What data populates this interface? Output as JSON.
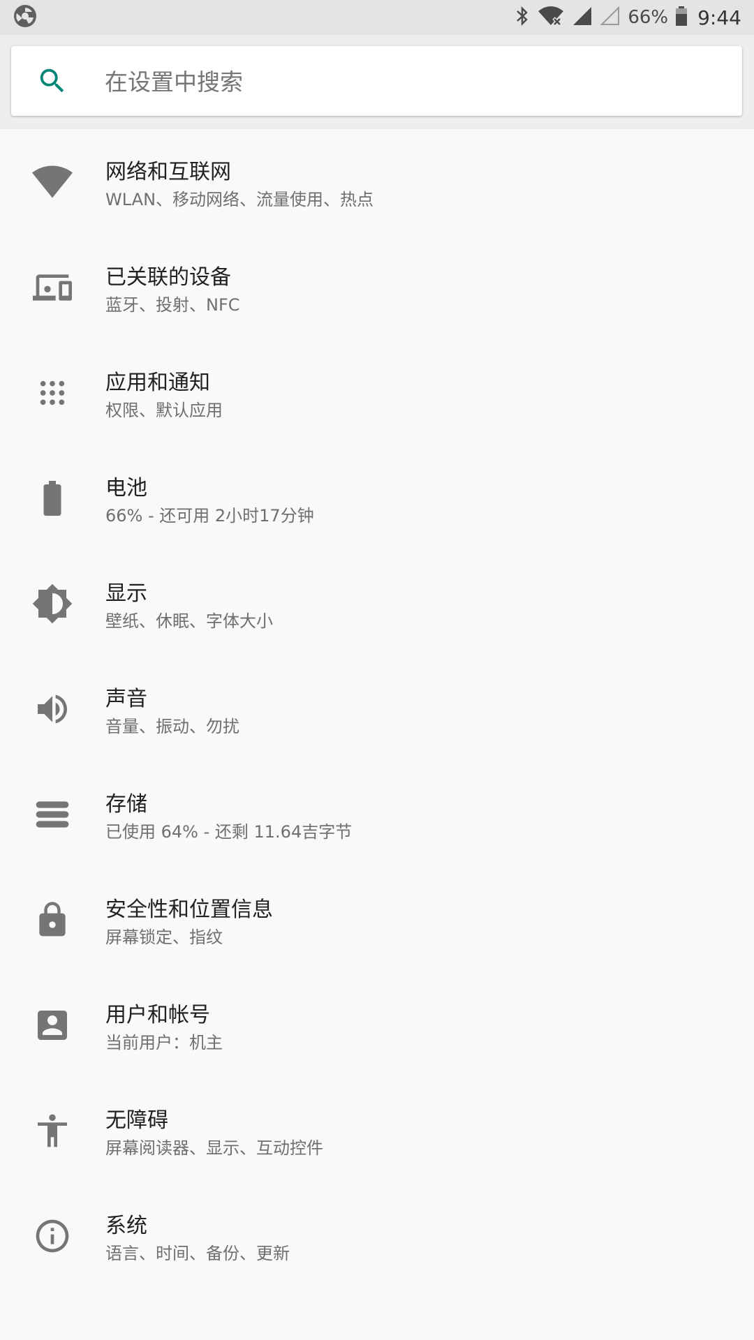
{
  "status_bar": {
    "battery_text": "66%",
    "time": "9:44",
    "icons": [
      "app-logo-icon",
      "bluetooth-icon",
      "wifi-off-icon",
      "signal-full-icon",
      "signal-empty-icon",
      "battery-icon"
    ]
  },
  "search": {
    "placeholder": "在设置中搜索",
    "icon": "search-icon",
    "accent_color": "#008577"
  },
  "settings": {
    "items": [
      {
        "title": "网络和互联网",
        "subtitle": "WLAN、移动网络、流量使用、热点",
        "icon": "wifi-icon"
      },
      {
        "title": "已关联的设备",
        "subtitle": "蓝牙、投射、NFC",
        "icon": "devices-icon"
      },
      {
        "title": "应用和通知",
        "subtitle": "权限、默认应用",
        "icon": "apps-icon"
      },
      {
        "title": "电池",
        "subtitle": "66% - 还可用 2小时17分钟",
        "icon": "battery-icon"
      },
      {
        "title": "显示",
        "subtitle": "壁纸、休眠、字体大小",
        "icon": "brightness-icon"
      },
      {
        "title": "声音",
        "subtitle": "音量、振动、勿扰",
        "icon": "volume-icon"
      },
      {
        "title": "存储",
        "subtitle": "已使用 64% - 还剩 11.64吉字节",
        "icon": "storage-icon"
      },
      {
        "title": "安全性和位置信息",
        "subtitle": "屏幕锁定、指纹",
        "icon": "lock-icon"
      },
      {
        "title": "用户和帐号",
        "subtitle": "当前用户：机主",
        "icon": "account-icon"
      },
      {
        "title": "无障碍",
        "subtitle": "屏幕阅读器、显示、互动控件",
        "icon": "accessibility-icon"
      },
      {
        "title": "系统",
        "subtitle": "语言、时间、备份、更新",
        "icon": "info-icon"
      }
    ]
  },
  "colors": {
    "icon_gray": "#757575",
    "title_text": "#212121",
    "subtitle_text": "#6f6f6f",
    "background": "#f9f9f9"
  }
}
